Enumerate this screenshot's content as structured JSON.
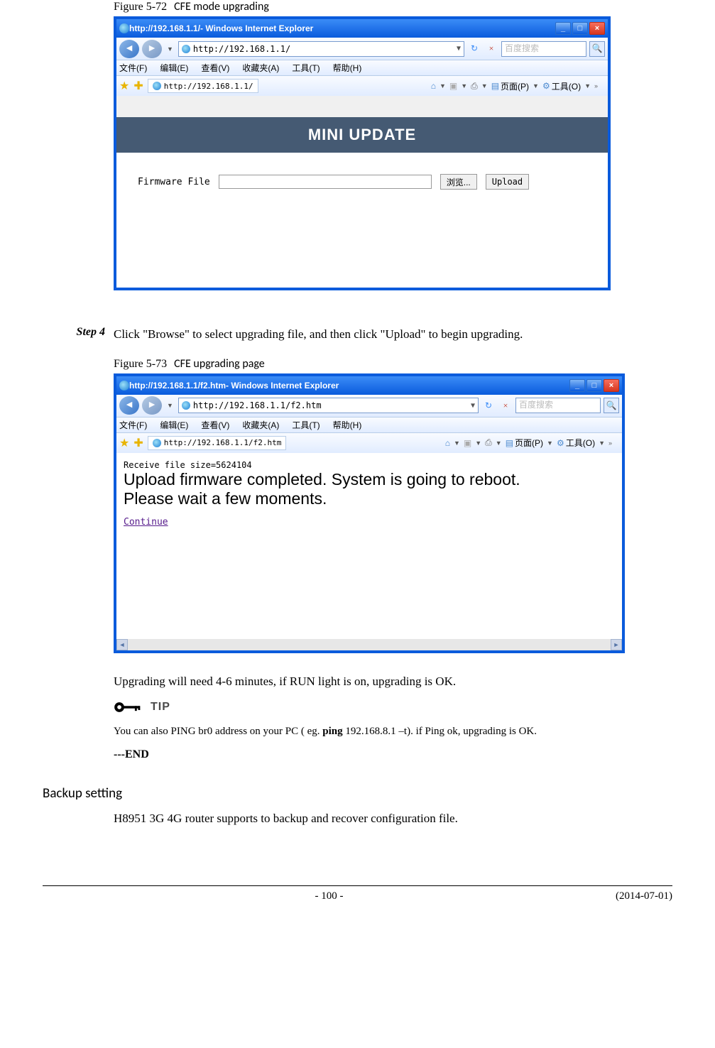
{
  "figure1": {
    "num": "Figure 5-72",
    "title": "CFE mode upgrading",
    "window_title_url": "http://192.168.1.1/",
    "window_title_app": " - Windows Internet Explorer",
    "address": "http://192.168.1.1/",
    "search_placeholder": "百度搜索",
    "menus": {
      "file": "文件(F)",
      "edit": "编辑(E)",
      "view": "查看(V)",
      "favs": "收藏夹(A)",
      "tools": "工具(T)",
      "help": "帮助(H)"
    },
    "tab": "http://192.168.1.1/",
    "tool_page": "页面(P)",
    "tool_tools": "工具(O)",
    "banner": "MINI UPDATE",
    "firmware_label": "Firmware File",
    "browse_btn": "浏览...",
    "upload_btn": "Upload"
  },
  "step4": {
    "label": "Step 4",
    "text": "Click \"Browse\" to select upgrading file, and then click \"Upload\" to begin upgrading."
  },
  "figure2": {
    "num": "Figure 5-73",
    "title": "CFE upgrading page",
    "window_title_url": "http://192.168.1.1/f2.htm",
    "window_title_app": " - Windows Internet Explorer",
    "address": "http://192.168.1.1/f2.htm",
    "search_placeholder": "百度搜索",
    "menus": {
      "file": "文件(F)",
      "edit": "编辑(E)",
      "view": "查看(V)",
      "favs": "收藏夹(A)",
      "tools": "工具(T)",
      "help": "帮助(H)"
    },
    "tab": "http://192.168.1.1/f2.htm",
    "tool_page": "页面(P)",
    "tool_tools": "工具(O)",
    "recv_line": "Receive file size=5624104",
    "big_line1": "Upload firmware completed.  System is going to reboot.",
    "big_line2": "Please wait a few moments.",
    "continue_link": "Continue"
  },
  "after_fig2": "Upgrading will need 4-6 minutes, if RUN light is on, upgrading is OK.",
  "tip": {
    "label": "TIP",
    "text_pre": "You can also PING br0 address on your PC ( eg. ",
    "cmd_bold": "ping",
    "cmd_rest": " 192.168.8.1 –t",
    "text_post": "). if Ping ok, upgrading is OK."
  },
  "end": "---END",
  "section": "Backup setting",
  "section_body": "H8951 3G 4G router    supports to backup and recover configuration file.",
  "footer": {
    "page": "- 100 -",
    "date": "(2014-07-01)"
  }
}
